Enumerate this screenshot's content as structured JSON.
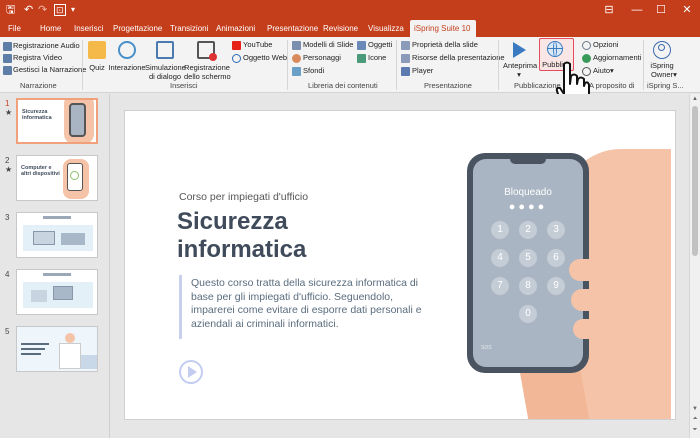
{
  "quick_access": {
    "save_icon": "save-icon",
    "undo_icon": "undo-icon",
    "redo_icon": "redo-icon",
    "slideshow_icon": "slideshow-icon",
    "customize": "▾"
  },
  "window_controls": [
    "restore",
    "minimize",
    "maximize",
    "close"
  ],
  "tabs": [
    "File",
    "Home",
    "Inserisci",
    "Progettazione",
    "Transizioni",
    "Animazioni",
    "Presentazione",
    "Revisione",
    "Visualizza",
    "iSpring Suite 10"
  ],
  "ribbon": {
    "narrazione": {
      "items": [
        "Registrazione Audio",
        "Registra Video",
        "Gestisci la Narrazione"
      ],
      "label": "Narrazione"
    },
    "inserisci": {
      "buttons": [
        "Quiz",
        "Interazione",
        "Simulazione\ndi dialogo",
        "Registrazione\ndello schermo"
      ],
      "small": [
        "YouTube",
        "Oggetto Web"
      ],
      "label": "Inserisci"
    },
    "libreria": {
      "col1": [
        "Modelli di Slide",
        "Personaggi",
        "Sfondi"
      ],
      "col2": [
        "Oggetti",
        "Icone"
      ],
      "label": "Libreria dei contenuti"
    },
    "presentazione": {
      "items": [
        "Proprietà della slide",
        "Risorse della presentazione",
        "Player"
      ],
      "label": "Presentazione"
    },
    "pubblicazione": {
      "buttons": [
        "Anteprima",
        "Pubblica"
      ],
      "anteprima_arrow": "▾",
      "label": "Pubblicazione"
    },
    "about": {
      "items": [
        "Opzioni",
        "Aggiornamenti",
        "Aiuto"
      ],
      "aiuto_arrow": "▾",
      "label": "A proposito di"
    },
    "ispring": {
      "button": "iSpring\nOwner",
      "owner_arrow": "▾",
      "label": "iSpring S..."
    }
  },
  "thumbnails": [
    {
      "num": "1",
      "star": "★",
      "selected": true,
      "title": "Sicurezza informatica"
    },
    {
      "num": "2",
      "star": "★",
      "selected": false,
      "title": "Computer e altri dispositivi"
    },
    {
      "num": "3",
      "star": "",
      "selected": false,
      "title": ""
    },
    {
      "num": "4",
      "star": "",
      "selected": false,
      "title": ""
    },
    {
      "num": "5",
      "star": "",
      "selected": false,
      "title": ""
    }
  ],
  "slide": {
    "subtitle": "Corso per impiegati d'ufficio",
    "title": "Sicurezza informatica",
    "body": "Questo corso tratta della sicurezza informatica di base per gli impiegati d'ufficio. Seguendolo, imparerei come evitare di esporre dati personali e aziendali ai criminali informatici.",
    "phone_text": "Bloqueado",
    "keypad": [
      "1",
      "2",
      "3",
      "4",
      "5",
      "6",
      "7",
      "8",
      "9",
      "0"
    ],
    "sos": "SOS"
  },
  "colors": {
    "accent": "#c43e1c",
    "ribbon_bg": "#f3f3f3",
    "highlight_box": "#e54c5c"
  }
}
